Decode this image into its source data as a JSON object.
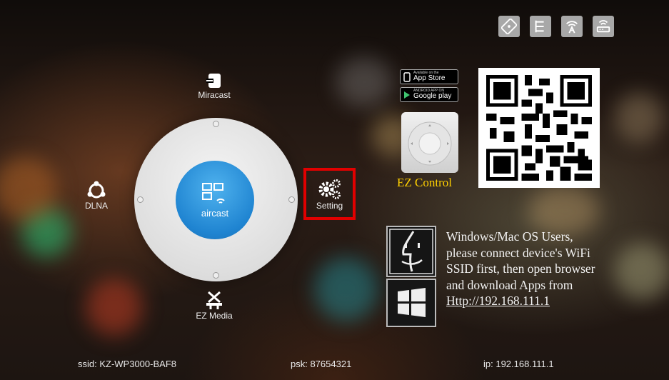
{
  "top_icons": [
    "remote-control-icon",
    "network-topology-icon",
    "antenna-signal-icon",
    "router-icon"
  ],
  "wheel": {
    "center_label": "aircast",
    "center_icon": "screen-mirroring-icon"
  },
  "menu": {
    "top": {
      "label": "Miracast",
      "icon": "miracast-icon"
    },
    "left": {
      "label": "DLNA",
      "icon": "dlna-icon"
    },
    "bottom": {
      "label": "EZ Media",
      "icon": "ez-media-icon"
    },
    "right": {
      "label": "Setting",
      "icon": "gears-icon",
      "highlight_color": "#e10000"
    }
  },
  "app_badges": {
    "app_store_small": "Available on the",
    "app_store_big": "App Store",
    "google_play_small": "ANDROID APP ON",
    "google_play_big": "Google play"
  },
  "ez_control_label": "EZ Control",
  "ez_control_color": "#ffd000",
  "instructions": {
    "line1": "Windows/Mac OS Users,",
    "line2": "please connect device's WiFi",
    "line3": "SSID first, then open browser",
    "line4": "and download Apps from",
    "url": "Http://192.168.111.1"
  },
  "status_bar": {
    "ssid": "ssid: KZ-WP3000-BAF8",
    "psk": "psk: 87654321",
    "ip": "ip: 192.168.111.1"
  },
  "colors": {
    "hub_blue": "#1f84d1",
    "highlight_red": "#e10000"
  }
}
